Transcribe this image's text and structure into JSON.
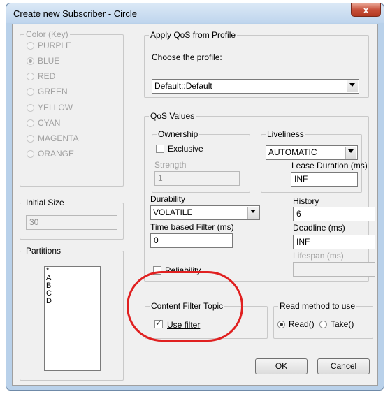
{
  "window": {
    "title": "Create new Subscriber - Circle",
    "close_glyph": "x"
  },
  "color_group": {
    "title": "Color (Key)",
    "options": [
      "PURPLE",
      "BLUE",
      "RED",
      "GREEN",
      "YELLOW",
      "CYAN",
      "MAGENTA",
      "ORANGE"
    ],
    "selected": "BLUE"
  },
  "initial_size": {
    "title": "Initial Size",
    "value": "30"
  },
  "partitions": {
    "title": "Partitions",
    "items": [
      "*",
      "A",
      "B",
      "C",
      "D"
    ]
  },
  "qos_profile": {
    "title": "Apply QoS from Profile",
    "label": "Choose the profile:",
    "value": "Default::Default"
  },
  "qos_values": {
    "title": "QoS Values",
    "ownership": {
      "title": "Ownership",
      "exclusive_label": "Exclusive",
      "exclusive_checked": false,
      "strength_label": "Strength",
      "strength_value": "1"
    },
    "liveliness": {
      "title": "Liveliness",
      "value": "AUTOMATIC",
      "lease_label": "Lease Duration (ms)",
      "lease_value": "INF"
    },
    "durability": {
      "label": "Durability",
      "value": "VOLATILE"
    },
    "history": {
      "label": "History",
      "value": "6"
    },
    "time_filter": {
      "label": "Time based Filter (ms)",
      "value": "0"
    },
    "deadline": {
      "label": "Deadline (ms)",
      "value": "INF"
    },
    "lifespan": {
      "label": "Lifespan (ms)",
      "value": ""
    },
    "reliability": {
      "label": "Reliability",
      "checked": false
    }
  },
  "content_filter": {
    "title": "Content Filter Topic",
    "use_filter_label": "Use filter",
    "checked": true
  },
  "read_method": {
    "title": "Read method to use",
    "read_label": "Read()",
    "take_label": "Take()",
    "selected": "Read()"
  },
  "buttons": {
    "ok": "OK",
    "cancel": "Cancel"
  },
  "colors": {
    "highlight_ring": "#e02020",
    "window_frame": "#b9d1ea",
    "close_button": "#c7503a"
  }
}
